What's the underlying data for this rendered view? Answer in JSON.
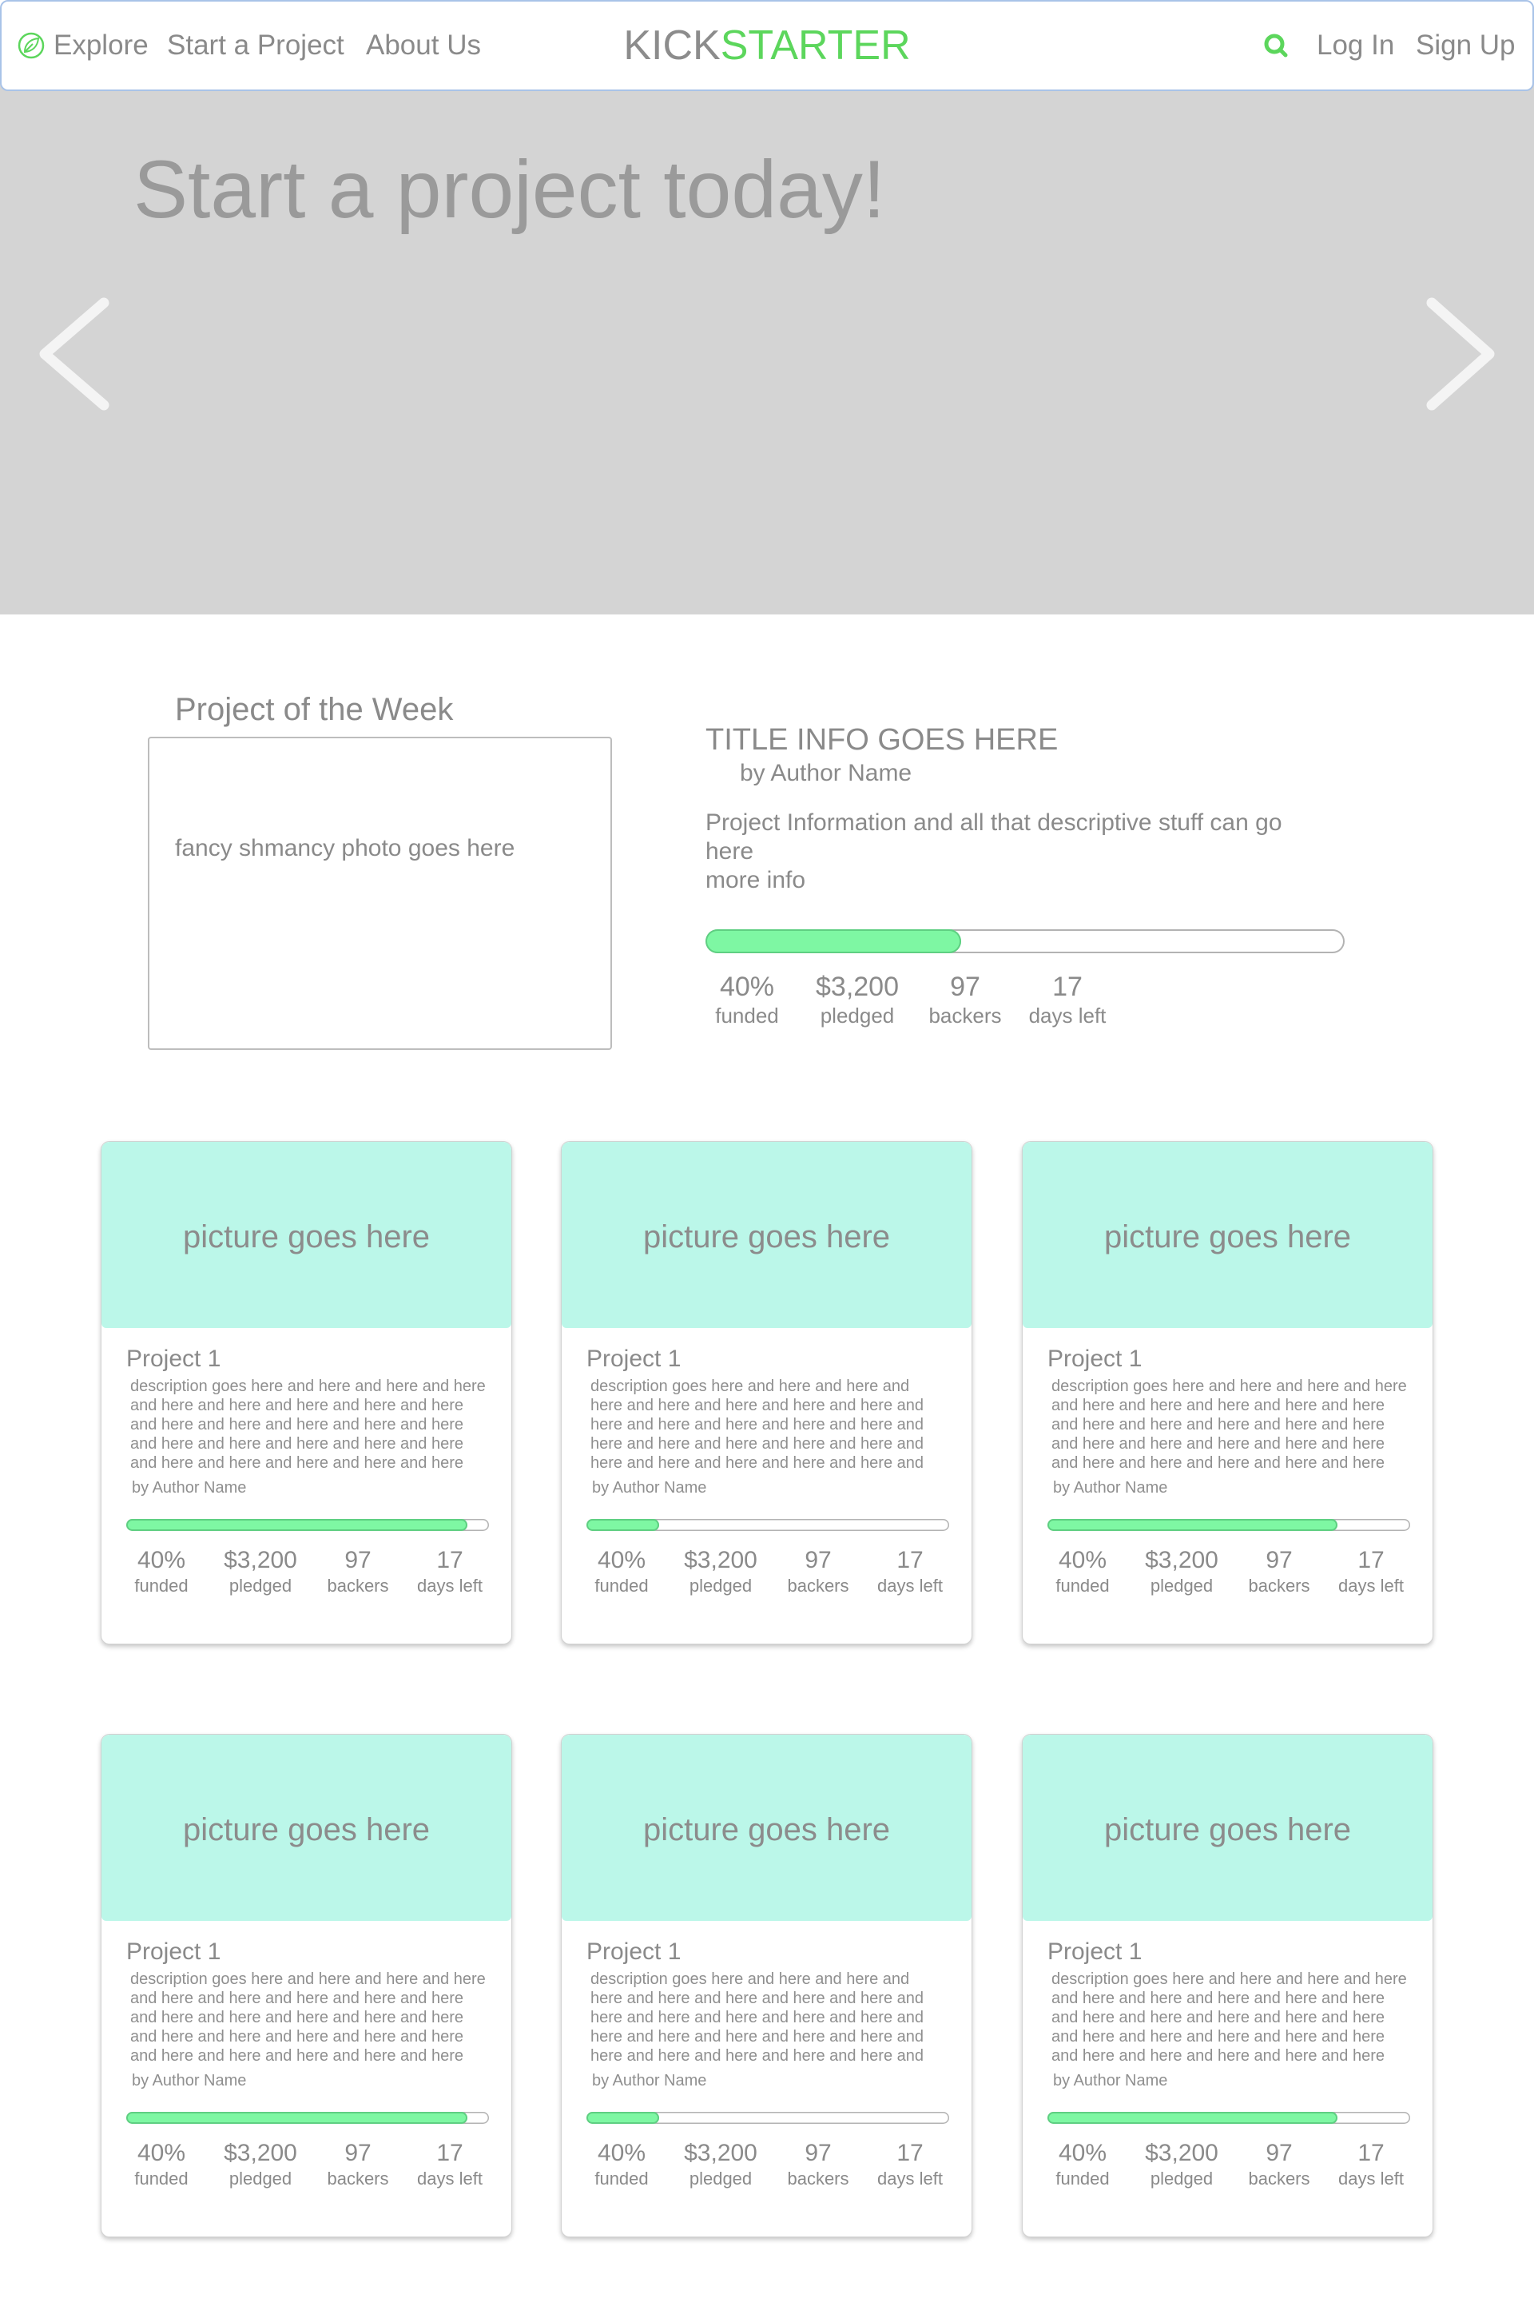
{
  "header": {
    "nav": [
      {
        "label": "Explore",
        "icon": "leaf-icon"
      },
      {
        "label": "Start a Project"
      },
      {
        "label": "About Us"
      }
    ],
    "logo": {
      "part1": "KICK",
      "part2": "STARTER"
    },
    "search_icon": "search-icon",
    "login_label": "Log In",
    "signup_label": "Sign Up"
  },
  "hero": {
    "title": "Start a project today!",
    "prev_icon": "chevron-left-icon",
    "next_icon": "chevron-right-icon"
  },
  "featured": {
    "section_label": "Project of the Week",
    "photo_placeholder": "fancy shmancy photo goes here",
    "title": "TITLE INFO GOES HERE",
    "author": "by Author Name",
    "description": "Project Information and all that descriptive stuff can go here",
    "more_info": "more info",
    "progress": 0.4,
    "stats": [
      {
        "value": "40%",
        "label": "funded"
      },
      {
        "value": "$3,200",
        "label": "pledged"
      },
      {
        "value": "97",
        "label": "backers"
      },
      {
        "value": "17",
        "label": "days left"
      }
    ]
  },
  "cards": [
    {
      "picture_label": "picture goes here",
      "title": "Project 1",
      "description_lines": [
        "description goes here and here and here and here",
        "and here and here and here and here and here",
        "and here and here and here and here and here",
        "and here and here and here and here and here",
        "and here and here and here and here and here"
      ],
      "author": "by Author Name",
      "progress": 0.94,
      "stats": [
        {
          "value": "40%",
          "label": "funded"
        },
        {
          "value": "$3,200",
          "label": "pledged"
        },
        {
          "value": "97",
          "label": "backers"
        },
        {
          "value": "17",
          "label": "days left"
        }
      ]
    },
    {
      "picture_label": "picture goes here",
      "title": "Project 1",
      "description_lines": [
        "description goes here and here and here and",
        "here and here and here and here and here and",
        "here and here and here and here and here and",
        "here and here and here and here and here and",
        "here and here and here and here and here and"
      ],
      "author": "by Author Name",
      "progress": 0.2,
      "stats": [
        {
          "value": "40%",
          "label": "funded"
        },
        {
          "value": "$3,200",
          "label": "pledged"
        },
        {
          "value": "97",
          "label": "backers"
        },
        {
          "value": "17",
          "label": "days left"
        }
      ]
    },
    {
      "picture_label": "picture goes here",
      "title": "Project 1",
      "description_lines": [
        "description goes here and here and here and here",
        "and here and here and here and here and here",
        "and here and here and here and here and here",
        "and here and here and here and here and here",
        "and here and here and here and here and here"
      ],
      "author": "by Author Name",
      "progress": 0.8,
      "stats": [
        {
          "value": "40%",
          "label": "funded"
        },
        {
          "value": "$3,200",
          "label": "pledged"
        },
        {
          "value": "97",
          "label": "backers"
        },
        {
          "value": "17",
          "label": "days left"
        }
      ]
    },
    {
      "picture_label": "picture goes here",
      "title": "Project 1",
      "description_lines": [
        "description goes here and here and here and here",
        "and here and here and here and here and here",
        "and here and here and here and here and here",
        "and here and here and here and here and here",
        "and here and here and here and here and here"
      ],
      "author": "by Author Name",
      "progress": 0.94,
      "stats": [
        {
          "value": "40%",
          "label": "funded"
        },
        {
          "value": "$3,200",
          "label": "pledged"
        },
        {
          "value": "97",
          "label": "backers"
        },
        {
          "value": "17",
          "label": "days left"
        }
      ]
    },
    {
      "picture_label": "picture goes here",
      "title": "Project 1",
      "description_lines": [
        "description goes here and here and here and",
        "here and here and here and here and here and",
        "here and here and here and here and here and",
        "here and here and here and here and here and",
        "here and here and here and here and here and"
      ],
      "author": "by Author Name",
      "progress": 0.2,
      "stats": [
        {
          "value": "40%",
          "label": "funded"
        },
        {
          "value": "$3,200",
          "label": "pledged"
        },
        {
          "value": "97",
          "label": "backers"
        },
        {
          "value": "17",
          "label": "days left"
        }
      ]
    },
    {
      "picture_label": "picture goes here",
      "title": "Project 1",
      "description_lines": [
        "description goes here and here and here and here",
        "and here and here and here and here and here",
        "and here and here and here and here and here",
        "and here and here and here and here and here",
        "and here and here and here and here and here"
      ],
      "author": "by Author Name",
      "progress": 0.8,
      "stats": [
        {
          "value": "40%",
          "label": "funded"
        },
        {
          "value": "$3,200",
          "label": "pledged"
        },
        {
          "value": "97",
          "label": "backers"
        },
        {
          "value": "17",
          "label": "days left"
        }
      ]
    }
  ],
  "colors": {
    "accent_green": "#5cd65c",
    "progress_green": "#7ef7a3",
    "hero_bg": "#d4d4d4",
    "picture_bg": "#bbf7e9",
    "text_gray": "#8a8a8a"
  }
}
